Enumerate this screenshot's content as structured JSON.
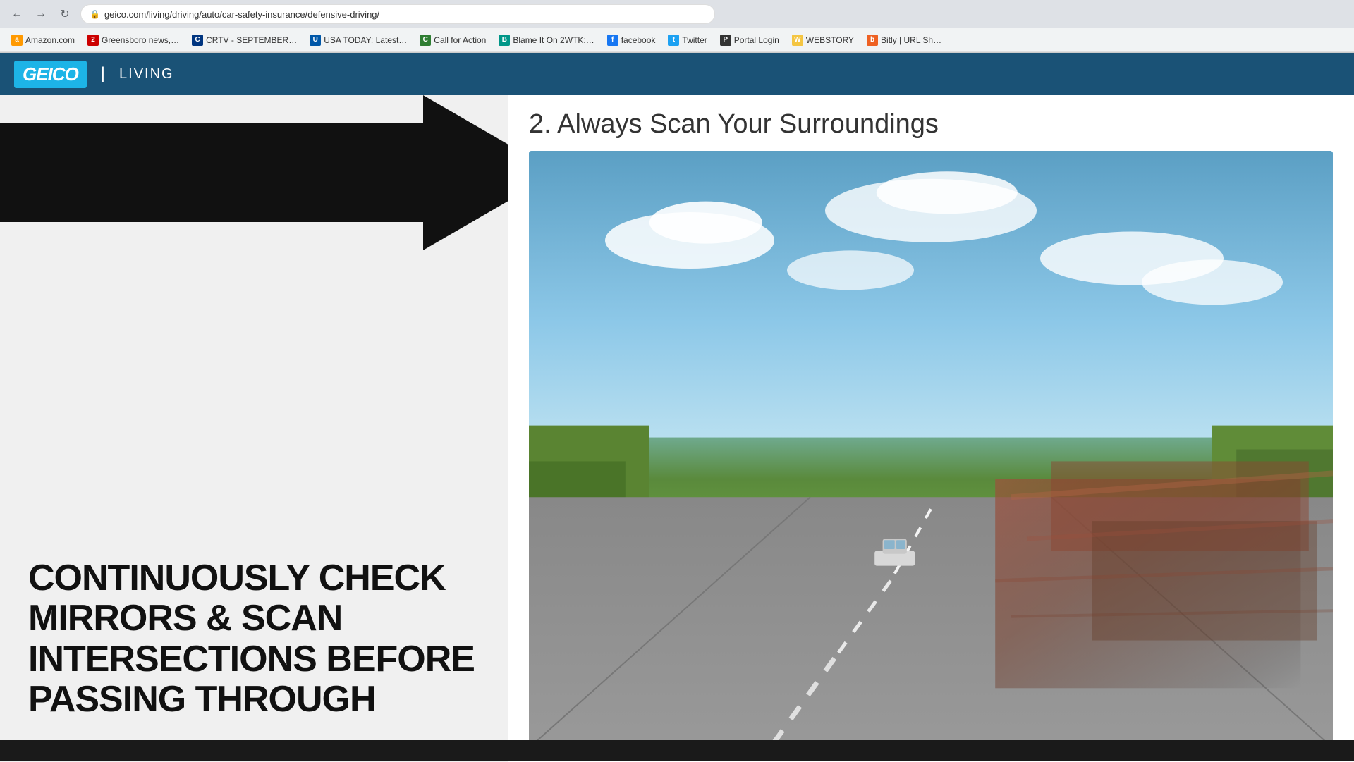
{
  "browser": {
    "url": "geico.com/living/driving/auto/car-safety-insurance/defensive-driving/",
    "nav": {
      "back_label": "←",
      "forward_label": "→",
      "reload_label": "↻"
    },
    "bookmarks": [
      {
        "id": "amazon",
        "label": "Amazon.com",
        "fav_class": "fav-amazon",
        "fav_text": "a"
      },
      {
        "id": "greensboro",
        "label": "Greensboro news,…",
        "fav_class": "fav-red",
        "fav_text": "2"
      },
      {
        "id": "crtv",
        "label": "CRTV - SEPTEMBER…",
        "fav_class": "fav-blue-dark",
        "fav_text": "C"
      },
      {
        "id": "usatoday",
        "label": "USA TODAY: Latest…",
        "fav_class": "fav-usa",
        "fav_text": "U"
      },
      {
        "id": "callforaction",
        "label": "Call for Action",
        "fav_class": "fav-green",
        "fav_text": "C"
      },
      {
        "id": "blame",
        "label": "Blame It On 2WTK:…",
        "fav_class": "fav-teal",
        "fav_text": "B"
      },
      {
        "id": "facebook",
        "label": "facebook",
        "fav_class": "fav-fb",
        "fav_text": "f"
      },
      {
        "id": "twitter",
        "label": "Twitter",
        "fav_class": "fav-tw",
        "fav_text": "t"
      },
      {
        "id": "portallogin",
        "label": "Portal Login",
        "fav_class": "fav-bx",
        "fav_text": "P"
      },
      {
        "id": "webstory",
        "label": "WEBSTORY",
        "fav_class": "fav-story",
        "fav_text": "W"
      },
      {
        "id": "bitly",
        "label": "Bitly | URL Sh…",
        "fav_class": "fav-bitly",
        "fav_text": "b"
      }
    ]
  },
  "geico": {
    "logo": "GEICO",
    "section": "LIVING"
  },
  "content": {
    "section_number": "2. Always Scan Your Surroundings",
    "tip_text": "CONTINUOUSLY CHECK MIRRORS & SCAN INTERSECTIONS BEFORE PASSING THROUGH"
  }
}
